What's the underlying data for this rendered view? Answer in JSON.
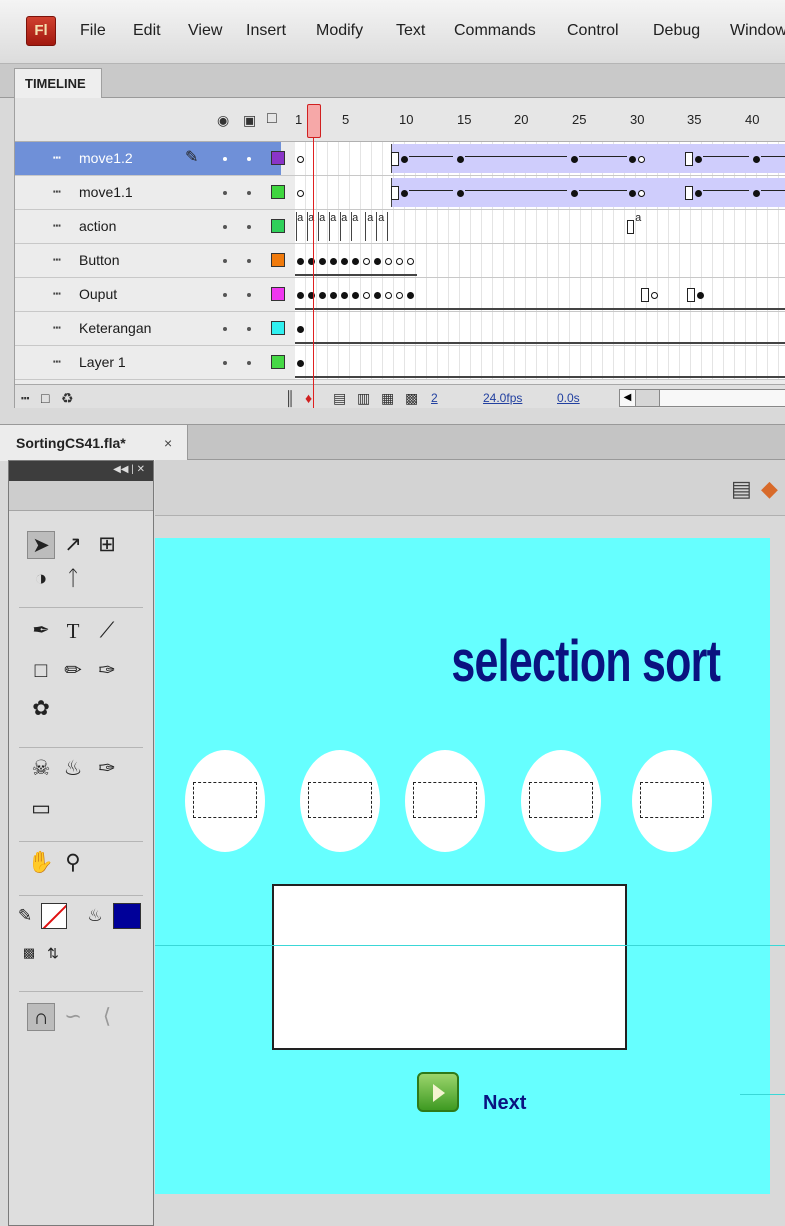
{
  "app": {
    "logo": "Fl"
  },
  "menu": [
    "File",
    "Edit",
    "View",
    "Insert",
    "Modify",
    "Text",
    "Commands",
    "Control",
    "Debug",
    "Window"
  ],
  "timeline": {
    "tab_label": "TIMELINE",
    "ruler_numbers": [
      "1",
      "5",
      "10",
      "15",
      "20",
      "25",
      "30",
      "35",
      "40"
    ],
    "layers": [
      {
        "name": "move1.2",
        "selected": true,
        "color": "#8a35c8"
      },
      {
        "name": "move1.1",
        "selected": false,
        "color": "#3fd63f"
      },
      {
        "name": "action",
        "selected": false,
        "color": "#2fd05a"
      },
      {
        "name": "Button",
        "selected": false,
        "color": "#f07a0c"
      },
      {
        "name": "Ouput",
        "selected": false,
        "color": "#f038f0"
      },
      {
        "name": "Keterangan",
        "selected": false,
        "color": "#30f0f0"
      },
      {
        "name": "Layer 1",
        "selected": false,
        "color": "#45d845"
      }
    ],
    "frame_labels": {
      "action": "a",
      "action_late": "a"
    },
    "footer": {
      "frame_number": "2",
      "fps": "24.0fps",
      "time": "0.0s"
    }
  },
  "document": {
    "tab_label": "SortingCS41.fla*",
    "close": "×"
  },
  "tools": {
    "stroke_color": "none",
    "fill_color": "#000099",
    "items": [
      "selection-tool",
      "subselection-tool",
      "free-transform-tool",
      "3d-rotation-tool",
      "lasso-tool",
      "pen-tool",
      "text-tool",
      "line-tool",
      "rectangle-tool",
      "pencil-tool",
      "brush-tool",
      "deco-tool",
      "bone-tool",
      "paint-bucket-tool",
      "eyedropper-tool",
      "eraser-tool",
      "hand-tool",
      "zoom-tool",
      "stroke-color",
      "fill-color",
      "swap-colors",
      "snap-to-objects",
      "smooth",
      "straighten"
    ]
  },
  "stage": {
    "background": "#66ffff",
    "title": "selection sort",
    "title_color": "#0a1380",
    "next_label": "Next",
    "next_label_color": "#0a1380",
    "guide_color": "#3ad7d7"
  }
}
